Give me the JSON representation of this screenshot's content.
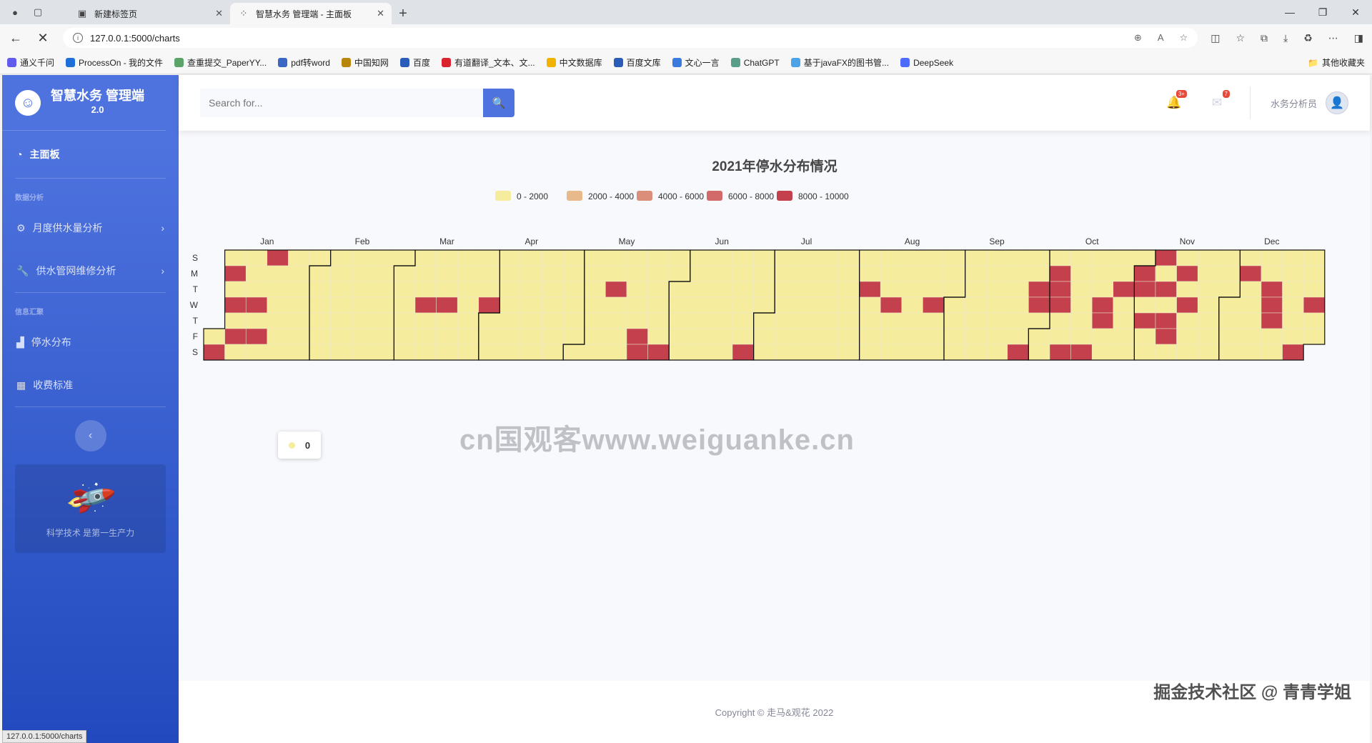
{
  "browser": {
    "tabs": [
      {
        "title": "新建标签页",
        "active": false
      },
      {
        "title": "智慧水务 管理端 - 主面板",
        "active": true
      }
    ],
    "url": "127.0.0.1:5000/charts",
    "status_url": "127.0.0.1:5000/charts",
    "bookmarks": [
      {
        "label": "通义千问",
        "color": "#615ced"
      },
      {
        "label": "ProcessOn - 我的文件",
        "color": "#1f6fd8"
      },
      {
        "label": "查重提交_PaperYY...",
        "color": "#5aa469"
      },
      {
        "label": "pdf转word",
        "color": "#3a66c4"
      },
      {
        "label": "中国知网",
        "color": "#b8860b"
      },
      {
        "label": "百度",
        "color": "#2b5db8"
      },
      {
        "label": "有道翻译_文本、文...",
        "color": "#d9232e"
      },
      {
        "label": "中文数据库",
        "color": "#f0b400"
      },
      {
        "label": "百度文库",
        "color": "#2b5db8"
      },
      {
        "label": "文心一言",
        "color": "#3b7be0"
      },
      {
        "label": "ChatGPT",
        "color": "#5a9e8a"
      },
      {
        "label": "基于javaFX的图书管...",
        "color": "#4ca3e8"
      },
      {
        "label": "DeepSeek",
        "color": "#4d6bfe"
      }
    ],
    "other_bookmarks": "其他收藏夹"
  },
  "sidebar": {
    "brand_title": "智慧水务 管理端",
    "brand_version": "2.0",
    "dashboard": "主面板",
    "heading_analysis": "数据分析",
    "item_monthly": "月度供水量分析",
    "item_maintenance": "供水管网维修分析",
    "heading_summary": "信息汇聚",
    "item_outage": "停水分布",
    "item_fees": "收费标准",
    "promo_text": "科学技术 是第一生产力"
  },
  "topbar": {
    "search_placeholder": "Search for...",
    "alerts_badge": "3+",
    "messages_badge": "7",
    "user_name": "水务分析员"
  },
  "tooltip": {
    "value": "0"
  },
  "footer": "Copyright © 走马&观花 2022",
  "watermark": "掘金技术社区 @ 青青学姐",
  "watermark2": "cn国观客www.weiguanke.cn",
  "colors": {
    "piece0": "#f5ec9e",
    "piece1": "#e8b98a",
    "piece2": "#db8f7b",
    "piece3": "#d26a6a",
    "piece4": "#c4404d",
    "accent": "#4e73df"
  },
  "chart_data": {
    "type": "heatmap",
    "subtype": "calendar",
    "title": "2021年停水分布情况",
    "year": 2021,
    "day_labels": [
      "S",
      "M",
      "T",
      "W",
      "T",
      "F",
      "S"
    ],
    "month_labels": [
      "Jan",
      "Feb",
      "Mar",
      "Apr",
      "May",
      "Jun",
      "Jul",
      "Aug",
      "Sep",
      "Oct",
      "Nov",
      "Dec"
    ],
    "legend": [
      "0 - 2000",
      "2000 - 4000",
      "4000 - 6000",
      "6000 - 8000",
      "8000 - 10000"
    ],
    "ranges": [
      [
        0,
        2000
      ],
      [
        2000,
        4000
      ],
      [
        4000,
        6000
      ],
      [
        6000,
        8000
      ],
      [
        8000,
        10000
      ]
    ],
    "default_value": 0,
    "high_value_dates": [
      "2021-01-02",
      "2021-01-04",
      "2021-01-06",
      "2021-01-08",
      "2021-01-13",
      "2021-01-15",
      "2021-01-17",
      "2021-03-10",
      "2021-03-17",
      "2021-03-31",
      "2021-05-11",
      "2021-05-21",
      "2021-05-22",
      "2021-05-29",
      "2021-06-26",
      "2021-08-03",
      "2021-08-11",
      "2021-08-25",
      "2021-09-25",
      "2021-09-28",
      "2021-09-29",
      "2021-10-04",
      "2021-10-05",
      "2021-10-06",
      "2021-10-09",
      "2021-10-16",
      "2021-10-20",
      "2021-10-21",
      "2021-10-26",
      "2021-11-01",
      "2021-11-02",
      "2021-11-04",
      "2021-11-07",
      "2021-11-09",
      "2021-11-11",
      "2021-11-12",
      "2021-11-15",
      "2021-11-17",
      "2021-12-06",
      "2021-12-14",
      "2021-12-15",
      "2021-12-16",
      "2021-12-25",
      "2021-12-29"
    ],
    "high_value": 9000
  }
}
